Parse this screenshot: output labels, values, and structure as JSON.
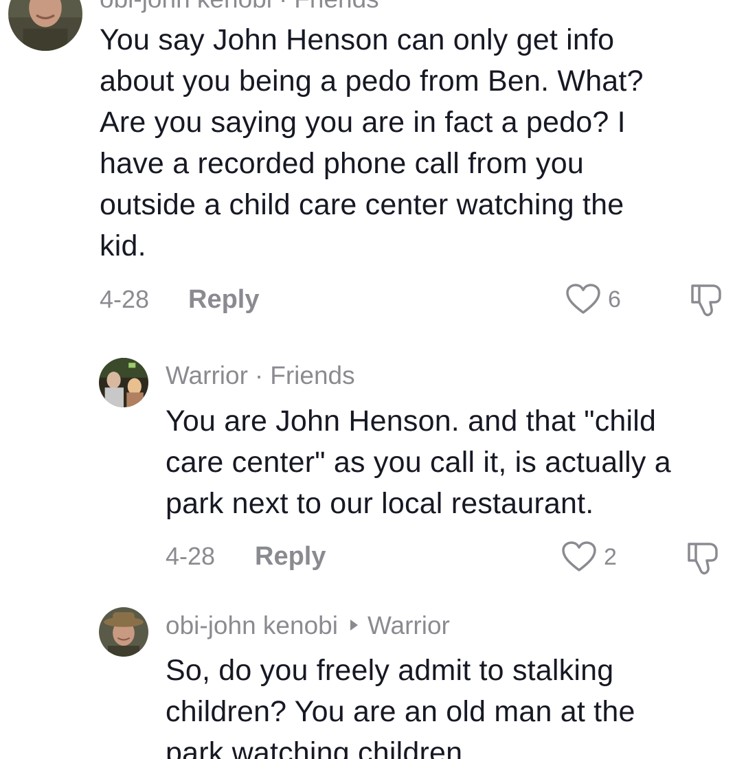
{
  "comments": [
    {
      "author": "obi-john kenobi",
      "relation": "Friends",
      "text_lines": [
        "You say John Henson can only get info",
        "about you being a pedo from Ben. What?",
        "Are you saying you are in fact a pedo? I",
        "have a recorded phone call from you",
        "outside a child care center watching the",
        "kid."
      ],
      "date": "4-28",
      "reply_label": "Reply",
      "likes": "6"
    },
    {
      "author": "Warrior",
      "separator": "·",
      "relation": "Friends",
      "text_lines": [
        "You are John Henson. and that \"child",
        "care center\" as you call it, is actually a",
        "park next to our local restaurant."
      ],
      "date": "4-28",
      "reply_label": "Reply",
      "likes": "2"
    },
    {
      "author": "obi-john kenobi",
      "reply_to": "Warrior",
      "text_lines": [
        "So, do you freely admit to stalking",
        "children? You are an old man at the",
        "park watching children"
      ]
    }
  ],
  "icons": {
    "like": "heart-outline-icon",
    "dislike": "thumbs-down-icon",
    "reply_arrow": "triangle-right-icon"
  },
  "colors": {
    "text": "#161823",
    "muted": "#8a8b91"
  }
}
